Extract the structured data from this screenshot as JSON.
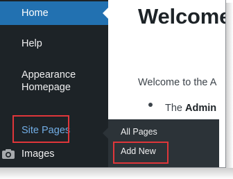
{
  "sidebar": {
    "items": [
      {
        "label": "Home"
      },
      {
        "label": "Help"
      },
      {
        "label": "Appearance"
      },
      {
        "label": "Homepage"
      },
      {
        "label": "Site Pages"
      },
      {
        "label": "Images",
        "icon": "camera-icon"
      }
    ],
    "submenu": {
      "items": [
        {
          "label": "All Pages"
        },
        {
          "label": "Add New"
        }
      ]
    }
  },
  "main": {
    "title": "Welcome",
    "intro": "Welcome to the A",
    "bullet_prefix": "The ",
    "bullet_bold": "Admin",
    "cut_text": "·"
  },
  "colors": {
    "sidebar_bg": "#1d2327",
    "current_item_bg": "#2271b1",
    "submenu_bg": "#2c3338",
    "highlight": "#e0363a",
    "active_link": "#72aee6"
  }
}
